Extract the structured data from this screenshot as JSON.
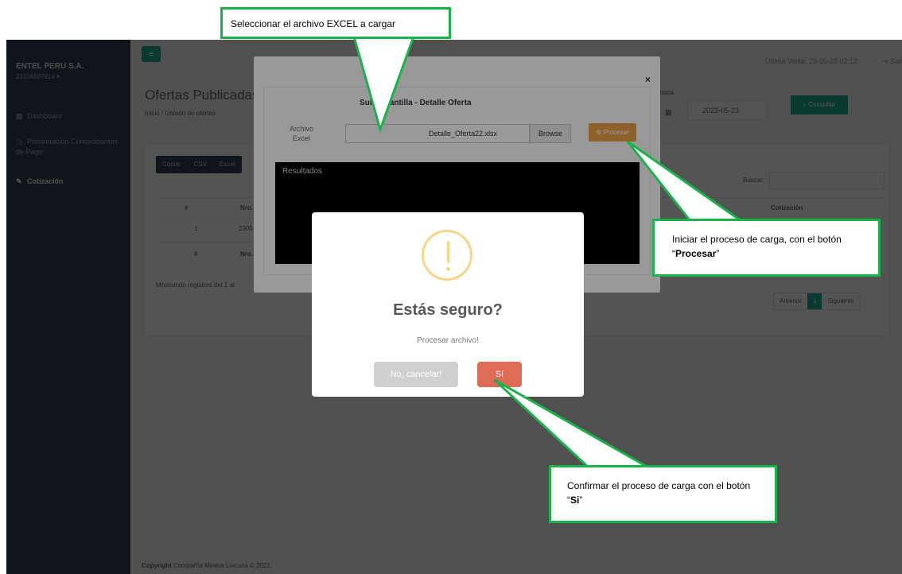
{
  "app": {
    "company": "ENTEL PERU S.A.",
    "company_sub": "20106897914 ▾",
    "nav": [
      "Dashboard",
      "Presentación Comprobantes de Pago",
      "Cotización"
    ],
    "last_visit": "Última Visita: 23-05-23 02:12",
    "logout": "Sali",
    "page_title": "Ofertas Publicadas",
    "breadcrumb": "Inicio / Listado de ofertas",
    "hasta_label": "Hasta",
    "date_value": "2023-05-23",
    "consult_label": "Consultar",
    "export_buttons": [
      "Copiar",
      "CSV",
      "Excel"
    ],
    "search_label": "Buscar:",
    "table_headers": [
      "#",
      "Nro.",
      "Cotización"
    ],
    "table_row": [
      "1",
      "2305"
    ],
    "showing": "Mostrando registros del 1 al",
    "pager": [
      "Anterior",
      "1",
      "Siguiente"
    ],
    "copyright_bold": "Copyright",
    "copyright_rest": "Compañía Minera Lincuna © 2021"
  },
  "upload_modal": {
    "title": "Subir Plantilla - Detalle Oferta",
    "file_label": "Archivo Excel",
    "file_value": "Detalle_Oferta22.xlsx",
    "browse_label": "Browse",
    "process_label": "Procesar",
    "results_label": "Resultados",
    "close": "×"
  },
  "confirm": {
    "title": "Estás seguro?",
    "text": "Procesar archivo!",
    "cancel_label": "No, cancelar!",
    "ok_label": "Sí"
  },
  "callouts": {
    "select_file": "Seleccionar el archivo EXCEL a cargar",
    "process_pre": "Iniciar el proceso de carga, con el botón “",
    "process_bold": "Procesar",
    "process_post": "”",
    "confirm_pre": "Confirmar el proceso de carga con el botón “",
    "confirm_bold": "Si",
    "confirm_post": "”"
  },
  "colors": {
    "callout_border": "#1bb24b",
    "warning": "#f8d486",
    "confirm_button": "#dd6b55",
    "process_button": "#f0a048",
    "brand_green": "#1ab394"
  }
}
